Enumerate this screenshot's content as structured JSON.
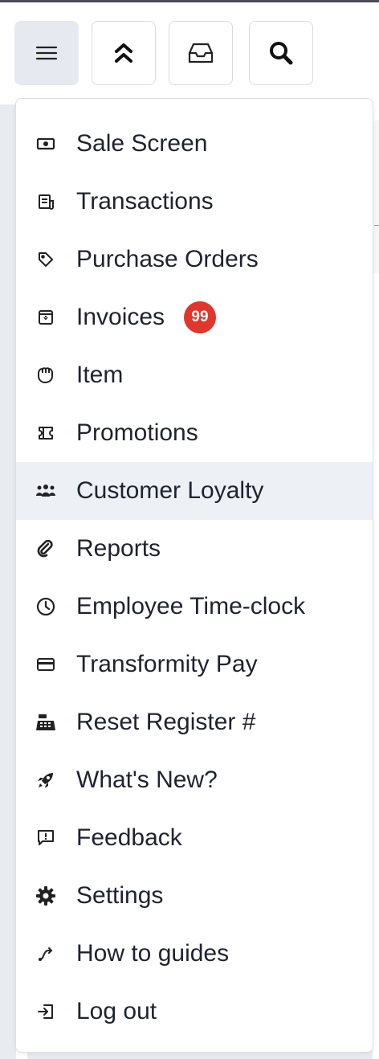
{
  "toolbar": {
    "buttons": [
      {
        "icon": "hamburger-icon"
      },
      {
        "icon": "chevrons-up-icon"
      },
      {
        "icon": "inbox-icon"
      },
      {
        "icon": "search-icon"
      }
    ]
  },
  "menu": {
    "items": [
      {
        "label": "Sale Screen",
        "icon": "cash-icon"
      },
      {
        "label": "Transactions",
        "icon": "receipt-icon"
      },
      {
        "label": "Purchase Orders",
        "icon": "tag-icon"
      },
      {
        "label": "Invoices",
        "icon": "archive-download-icon",
        "badge": "99"
      },
      {
        "label": "Item",
        "icon": "hand-icon"
      },
      {
        "label": "Promotions",
        "icon": "ticket-icon"
      },
      {
        "label": "Customer Loyalty",
        "icon": "users-icon",
        "active": true
      },
      {
        "label": "Reports",
        "icon": "paperclip-icon"
      },
      {
        "label": "Employee Time-clock",
        "icon": "clock-icon"
      },
      {
        "label": "Transformity Pay",
        "icon": "credit-card-icon"
      },
      {
        "label": "Reset Register #",
        "icon": "cash-register-icon"
      },
      {
        "label": "What's New?",
        "icon": "rocket-icon"
      },
      {
        "label": "Feedback",
        "icon": "chat-alert-icon"
      },
      {
        "label": "Settings",
        "icon": "gear-icon"
      },
      {
        "label": "How to guides",
        "icon": "route-icon"
      },
      {
        "label": "Log out",
        "icon": "logout-icon"
      }
    ]
  },
  "colors": {
    "badge": "#e0362b",
    "active_row": "#edf0f5",
    "text": "#1e2330"
  }
}
